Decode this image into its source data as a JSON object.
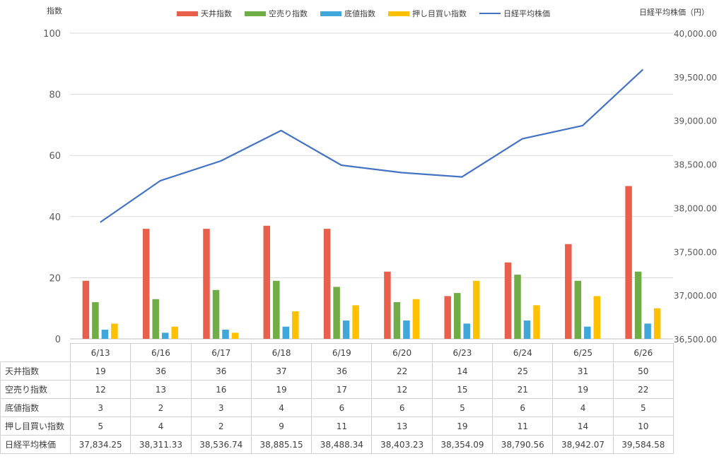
{
  "chart_data": {
    "type": "bar",
    "categories": [
      "6/13",
      "6/16",
      "6/17",
      "6/18",
      "6/19",
      "6/20",
      "6/23",
      "6/24",
      "6/25",
      "6/26"
    ],
    "series": [
      {
        "name": "天井指数",
        "type": "bar",
        "axis": "left",
        "color": "#E8604C",
        "values": [
          19,
          36,
          36,
          37,
          36,
          22,
          14,
          25,
          31,
          50
        ]
      },
      {
        "name": "空売り指数",
        "type": "bar",
        "axis": "left",
        "color": "#70AD47",
        "values": [
          12,
          13,
          16,
          19,
          17,
          12,
          15,
          21,
          19,
          22
        ]
      },
      {
        "name": "底値指数",
        "type": "bar",
        "axis": "left",
        "color": "#41A6D9",
        "values": [
          3,
          2,
          3,
          4,
          6,
          6,
          5,
          6,
          4,
          5
        ]
      },
      {
        "name": "押し目買い指数",
        "type": "bar",
        "axis": "left",
        "color": "#FFC000",
        "values": [
          5,
          4,
          2,
          9,
          11,
          13,
          19,
          11,
          14,
          10
        ]
      },
      {
        "name": "日経平均株価",
        "type": "line",
        "axis": "right",
        "color": "#4472C4",
        "values": [
          37834.25,
          38311.33,
          38536.74,
          38885.15,
          38488.34,
          38403.23,
          38354.09,
          38790.56,
          38942.07,
          39584.58
        ],
        "labels": [
          "37,834.25",
          "38,311.33",
          "38,536.74",
          "38,885.15",
          "38,488.34",
          "38,403.23",
          "38,354.09",
          "38,790.56",
          "38,942.07",
          "39,584.58"
        ]
      }
    ],
    "ylabel": "指数",
    "y2label": "日経平均株価（円）",
    "ylim": [
      0,
      100
    ],
    "y_ticks": [
      "0",
      "20",
      "40",
      "60",
      "80",
      "100"
    ],
    "y2lim": [
      36500,
      40000
    ],
    "y2_ticks": [
      "36,500.00",
      "37,000.00",
      "37,500.00",
      "38,000.00",
      "38,500.00",
      "39,000.00",
      "39,500.00",
      "40,000.00"
    ],
    "grid": true,
    "legend_position": "top",
    "data_table": true
  }
}
